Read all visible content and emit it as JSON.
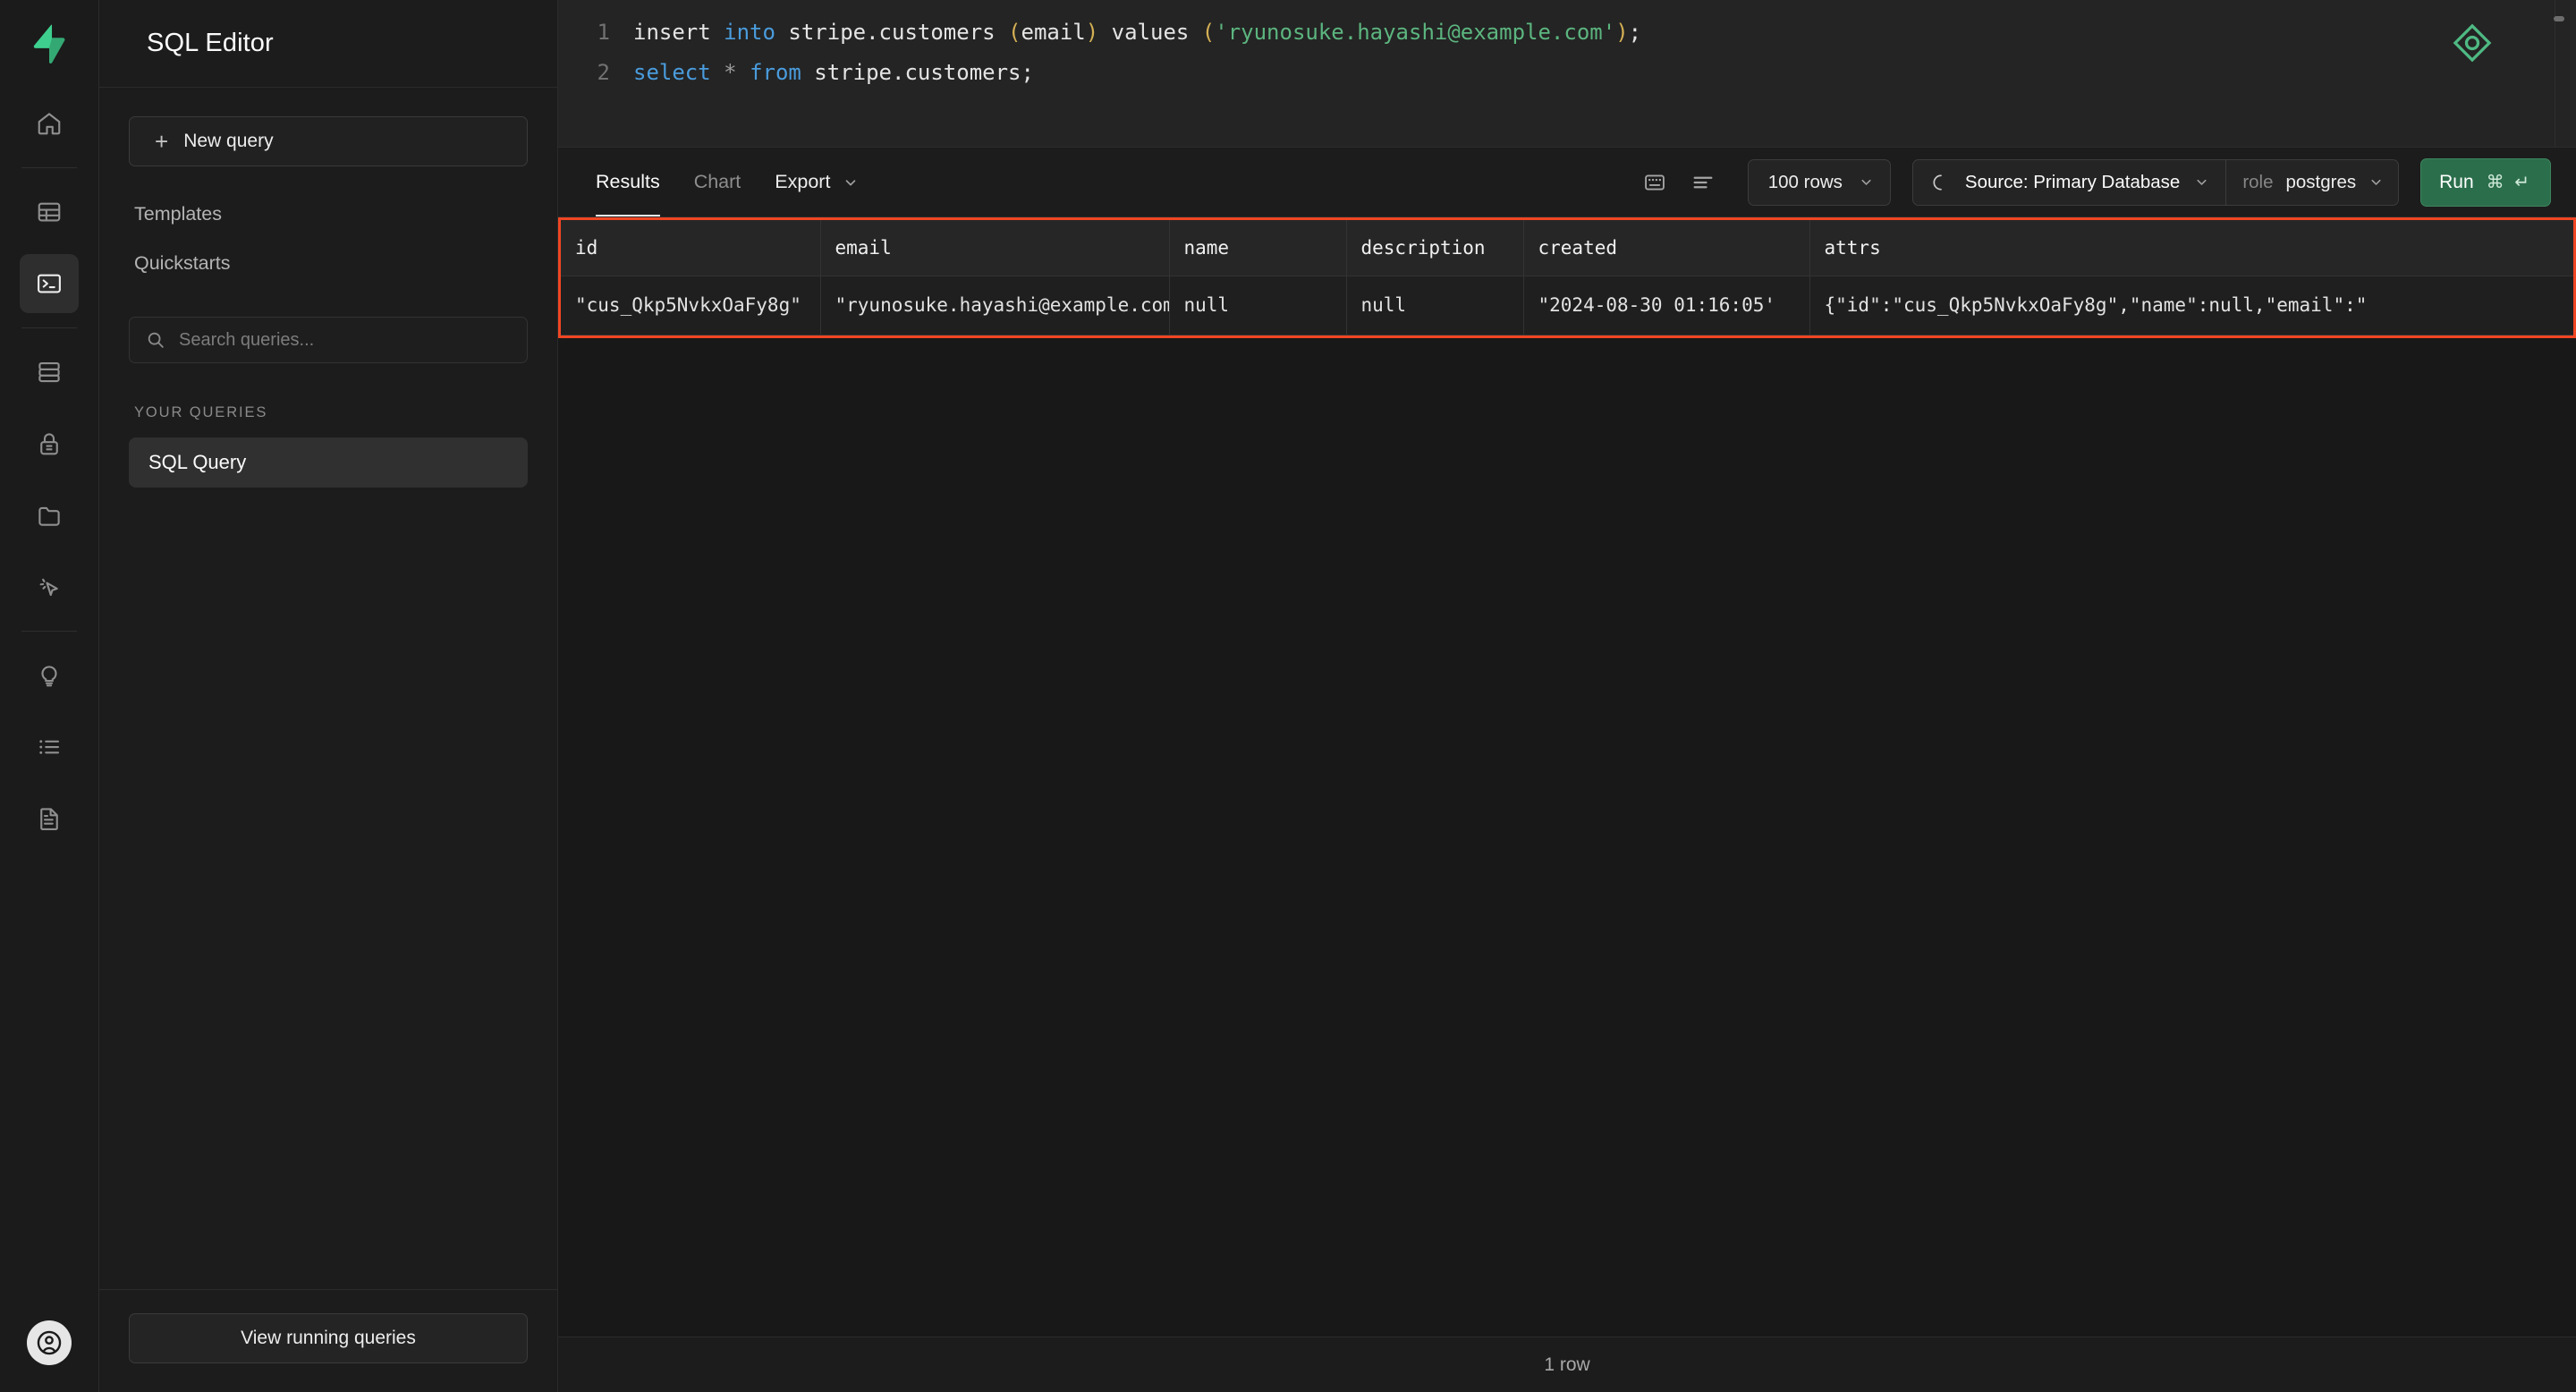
{
  "rail": {
    "logo": "supabase-logo",
    "items": [
      {
        "id": "home",
        "icon": "home-icon",
        "active": false
      },
      {
        "id": "table-editor",
        "icon": "table-icon",
        "active": false
      },
      {
        "id": "sql-editor",
        "icon": "terminal-icon",
        "active": true
      },
      {
        "id": "database",
        "icon": "database-icon",
        "active": false
      },
      {
        "id": "auth",
        "icon": "lock-icon",
        "active": false
      },
      {
        "id": "storage",
        "icon": "folder-icon",
        "active": false
      },
      {
        "id": "functions",
        "icon": "cursor-click-icon",
        "active": false
      },
      {
        "id": "advisors",
        "icon": "lightbulb-icon",
        "active": false
      },
      {
        "id": "logs",
        "icon": "list-icon",
        "active": false
      },
      {
        "id": "api-docs",
        "icon": "document-icon",
        "active": false
      }
    ],
    "avatar": "user-avatar-icon"
  },
  "panel": {
    "title": "SQL Editor",
    "new_query_label": "New query",
    "new_query_icon": "plus-icon",
    "links": [
      {
        "label": "Templates"
      },
      {
        "label": "Quickstarts"
      }
    ],
    "search": {
      "placeholder": "Search queries...",
      "value": "",
      "icon": "search-icon"
    },
    "section_label": "YOUR QUERIES",
    "queries": [
      {
        "label": "SQL Query",
        "selected": true
      }
    ],
    "footer_button": "View running queries"
  },
  "editor": {
    "lines": [
      {
        "number": "1",
        "tokens": [
          {
            "t": "insert ",
            "c": "plain"
          },
          {
            "t": "into",
            "c": "kw"
          },
          {
            "t": " stripe.customers ",
            "c": "plain"
          },
          {
            "t": "(",
            "c": "punc"
          },
          {
            "t": "email",
            "c": "plain"
          },
          {
            "t": ")",
            "c": "punc"
          },
          {
            "t": " values ",
            "c": "plain"
          },
          {
            "t": "(",
            "c": "punc"
          },
          {
            "t": "'ryunosuke.hayashi@example.com'",
            "c": "str"
          },
          {
            "t": ")",
            "c": "punc"
          },
          {
            "t": ";",
            "c": "plain"
          }
        ]
      },
      {
        "number": "2",
        "tokens": [
          {
            "t": "select",
            "c": "kw"
          },
          {
            "t": " ",
            "c": "plain"
          },
          {
            "t": "*",
            "c": "op"
          },
          {
            "t": " ",
            "c": "plain"
          },
          {
            "t": "from",
            "c": "kw"
          },
          {
            "t": " stripe.customers;",
            "c": "plain"
          }
        ]
      }
    ],
    "ai_icon": "ai-assistant-diamond-icon"
  },
  "toolbar": {
    "tabs": [
      {
        "label": "Results",
        "active": true,
        "disabled": false
      },
      {
        "label": "Chart",
        "active": false,
        "disabled": true
      },
      {
        "label": "Export",
        "active": false,
        "disabled": false,
        "chevron": "chevron-down-icon"
      }
    ],
    "keyboard_icon": "keyboard-icon",
    "format_icon": "align-left-icon",
    "rows_label": "100 rows",
    "rows_chevron": "chevron-down-icon",
    "source_icon": "loading-spinner-icon",
    "source_label": "Source: Primary Database",
    "source_chevron": "chevron-down-icon",
    "role_prefix": "role",
    "role_value": "postgres",
    "role_chevron": "chevron-down-icon",
    "run_label": "Run",
    "run_shortcut": "⌘ ↵",
    "run_color": "#2b6e4b"
  },
  "results": {
    "highlight_color": "#f04623",
    "columns": [
      "id",
      "email",
      "name",
      "description",
      "created",
      "attrs"
    ],
    "rows": [
      [
        "\"cus_Qkp5NvkxOaFy8g\"",
        "\"ryunosuke.hayashi@example.com\"",
        "null",
        "null",
        "\"2024-08-30 01:16:05'",
        "{\"id\":\"cus_Qkp5NvkxOaFy8g\",\"name\":null,\"email\":\""
      ]
    ],
    "status": "1 row"
  }
}
